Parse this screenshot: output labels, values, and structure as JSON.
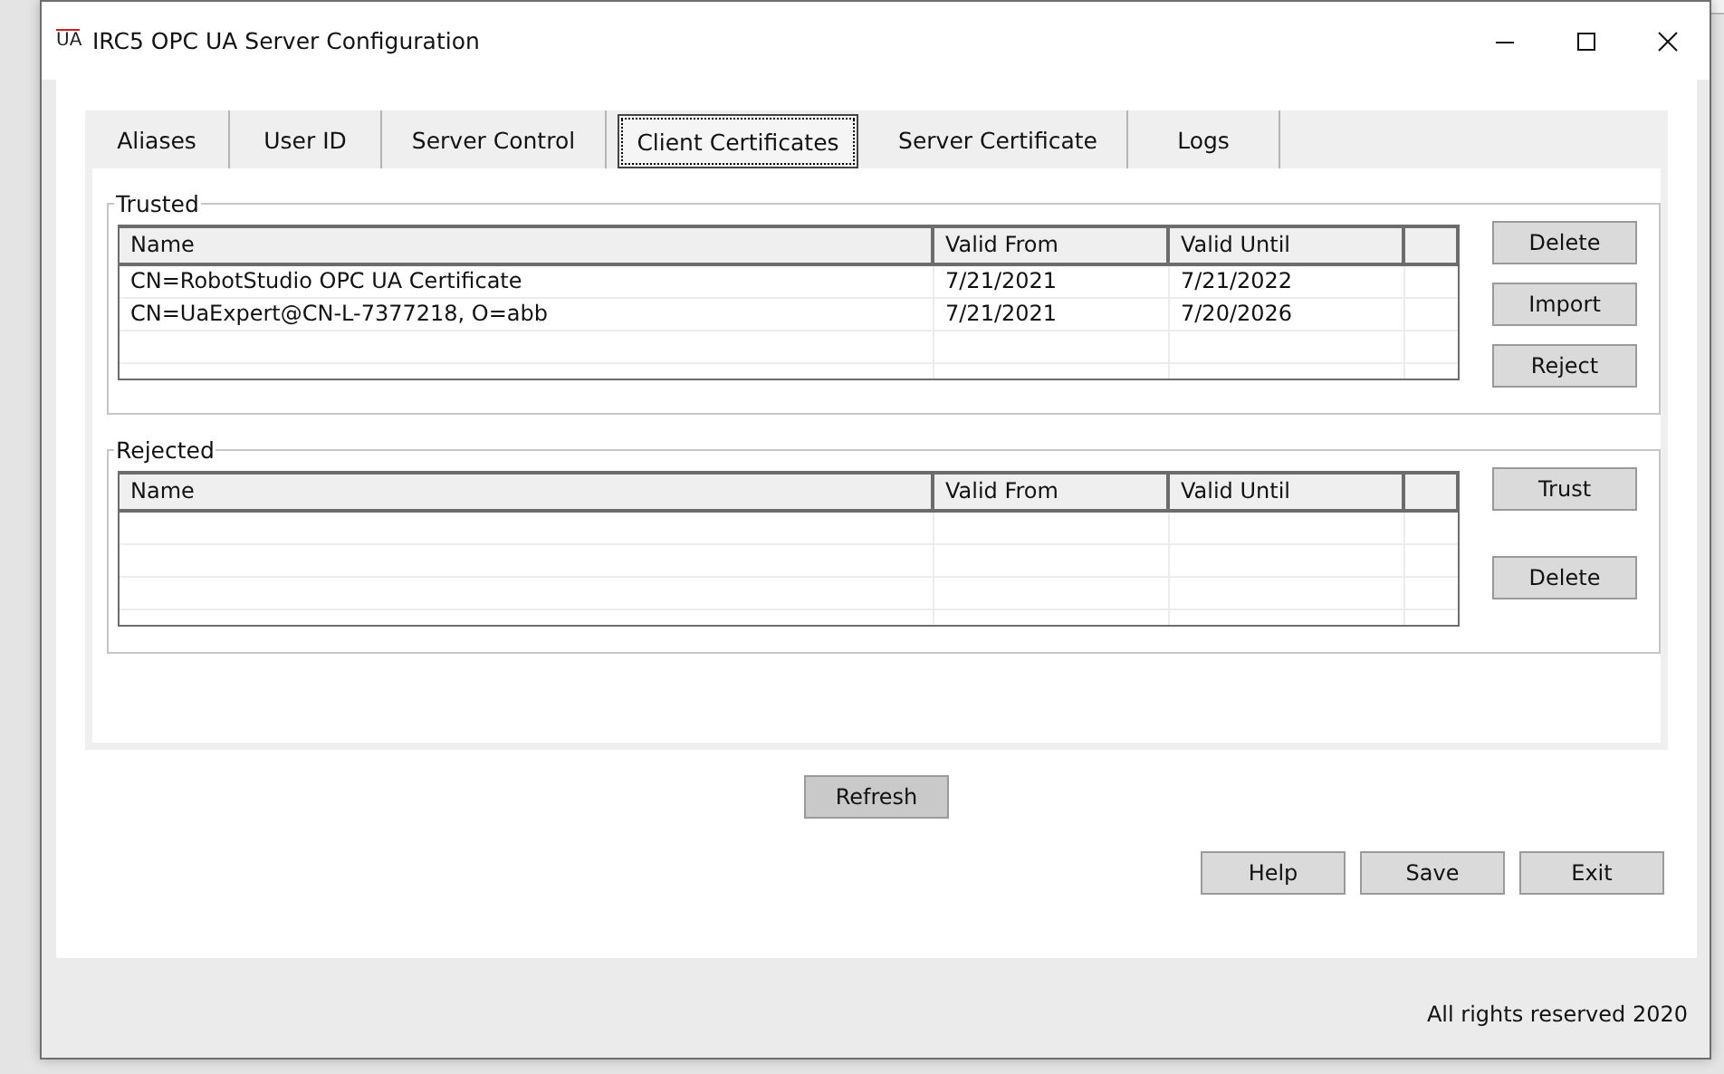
{
  "window": {
    "logo": "UA",
    "title": "IRC5 OPC UA Server Configuration"
  },
  "tabs": [
    {
      "label": "Aliases",
      "selected": false
    },
    {
      "label": "User ID",
      "selected": false
    },
    {
      "label": "Server Control",
      "selected": false
    },
    {
      "label": "Client Certificates",
      "selected": true
    },
    {
      "label": "Server Certificate",
      "selected": false
    },
    {
      "label": "Logs",
      "selected": false
    }
  ],
  "groups": [
    {
      "title": "Trusted",
      "columns": [
        "Name",
        "Valid From",
        "Valid Until"
      ],
      "rows": [
        [
          "CN=RobotStudio OPC UA Certificate",
          "7/21/2021",
          "7/21/2022"
        ],
        [
          "CN=UaExpert@CN-L-7377218, O=abb",
          "7/21/2021",
          "7/20/2026"
        ]
      ],
      "buttons": [
        "Delete",
        "Import",
        "Reject"
      ]
    },
    {
      "title": "Rejected",
      "columns": [
        "Name",
        "Valid From",
        "Valid Until"
      ],
      "buttons": [
        "Trust",
        "Delete"
      ]
    }
  ],
  "refresh_button": "Refresh",
  "footer_buttons": [
    "Help",
    "Save",
    "Exit"
  ],
  "copyright": "All rights reserved 2020"
}
